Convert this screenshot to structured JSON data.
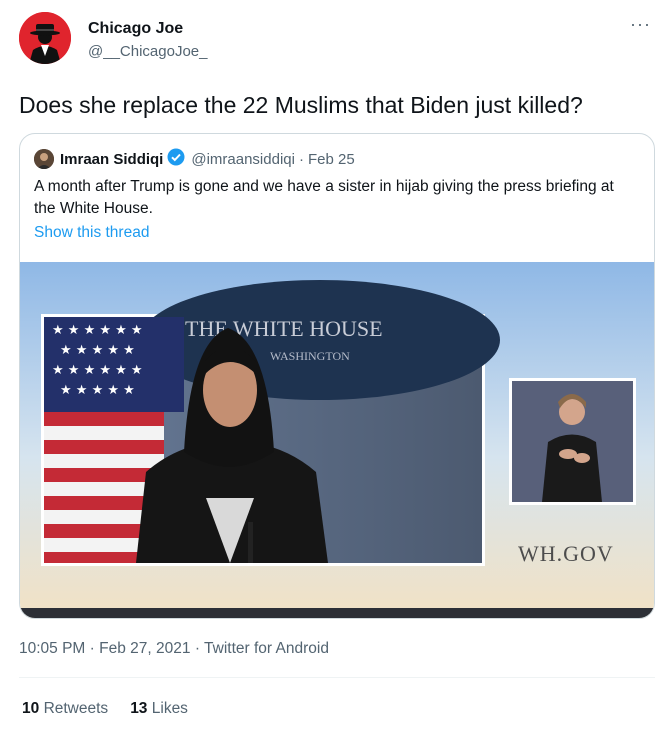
{
  "author": {
    "display_name": "Chicago Joe",
    "handle": "@__ChicagoJoe_"
  },
  "more_label": "···",
  "tweet": {
    "text": "Does she replace the 22 Muslims that Biden just killed?"
  },
  "quote": {
    "display_name": "Imraan Siddiqi",
    "handle": "@imraansiddiqi",
    "date": "Feb 25",
    "separator": "·",
    "text": "A month after Trump is gone and we have a sister in hijab giving the press briefing at the White House.",
    "show_thread": "Show this thread",
    "media": {
      "sign_text": "THE WHITE HOUSE",
      "sign_subtext": "WASHINGTON",
      "watermark": "WH.GOV"
    }
  },
  "footer": {
    "time": "10:05 PM",
    "date": "Feb 27, 2021",
    "client": "Twitter for Android",
    "separator": "·"
  },
  "stats": {
    "retweets_count": "10",
    "retweets_label": "Retweets",
    "likes_count": "13",
    "likes_label": "Likes"
  },
  "colors": {
    "accent": "#1d9bf0",
    "verified": "#1d9bf0",
    "avatar_bg": "#e0242d"
  },
  "icons": [
    "gangster-avatar-icon",
    "verified-badge-icon",
    "more-icon"
  ]
}
